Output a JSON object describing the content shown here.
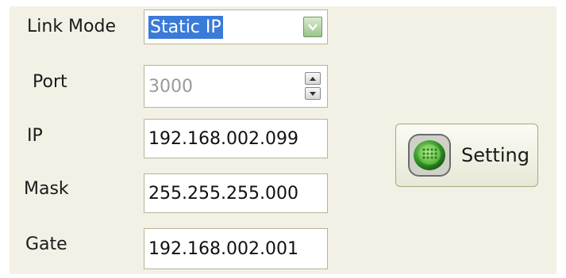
{
  "link_mode": {
    "label": "Link Mode",
    "value": "Static IP",
    "icon": "chevron-down-icon"
  },
  "port": {
    "label": "Port",
    "value": "3000",
    "icons": [
      "spinner-up-icon",
      "spinner-down-icon"
    ]
  },
  "ip": {
    "label": "IP",
    "value": "192.168.002.099"
  },
  "mask": {
    "label": "Mask",
    "value": "255.255.255.000"
  },
  "gate": {
    "label": "Gate",
    "value": "192.168.002.001"
  },
  "setting_button": {
    "label": "Setting",
    "icon": "green-grid-icon"
  },
  "colors": {
    "panel_bg": "#f3f1e5",
    "selection": "#3a7ad9",
    "icon_green": "#3ea52e",
    "button_border": "#a0ab80"
  }
}
